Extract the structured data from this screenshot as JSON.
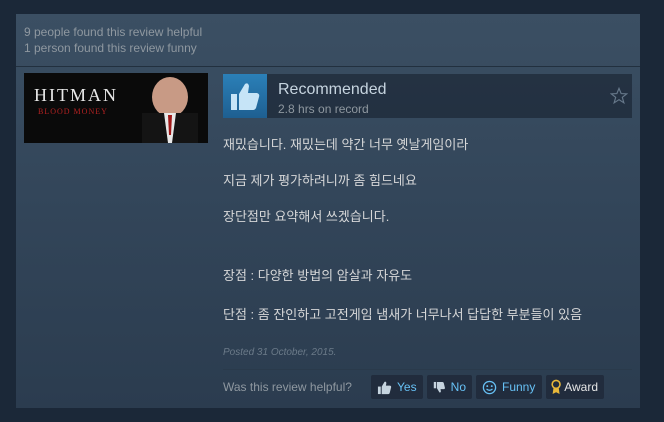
{
  "stats": {
    "helpful": "9 people found this review helpful",
    "funny": "1 person found this review funny"
  },
  "game": {
    "title": "HITMAN",
    "subtitle": "BLOOD MONEY"
  },
  "review": {
    "verdict": "Recommended",
    "hours": "2.8 hrs on record",
    "lines": [
      "재밌습니다. 재밌는데 약간 너무 옛날게임이라",
      "지금 제가 평가하려니까 좀 힘드네요",
      "장단점만 요약해서 쓰겠습니다.",
      "장점 : 다양한 방법의 암살과 자유도",
      "단점 : 좀 잔인하고 고전게임 냄새가 너무나서 답답한 부분들이 있음"
    ],
    "posted": "Posted 31 October, 2015."
  },
  "footer": {
    "question": "Was this review helpful?",
    "yes": "Yes",
    "no": "No",
    "funny": "Funny",
    "award": "Award"
  },
  "colors": {
    "page_bg": "#1b2838",
    "link": "#67c1f5",
    "thumb_bg": "#2b80b8",
    "text": "#d6d7d8"
  }
}
